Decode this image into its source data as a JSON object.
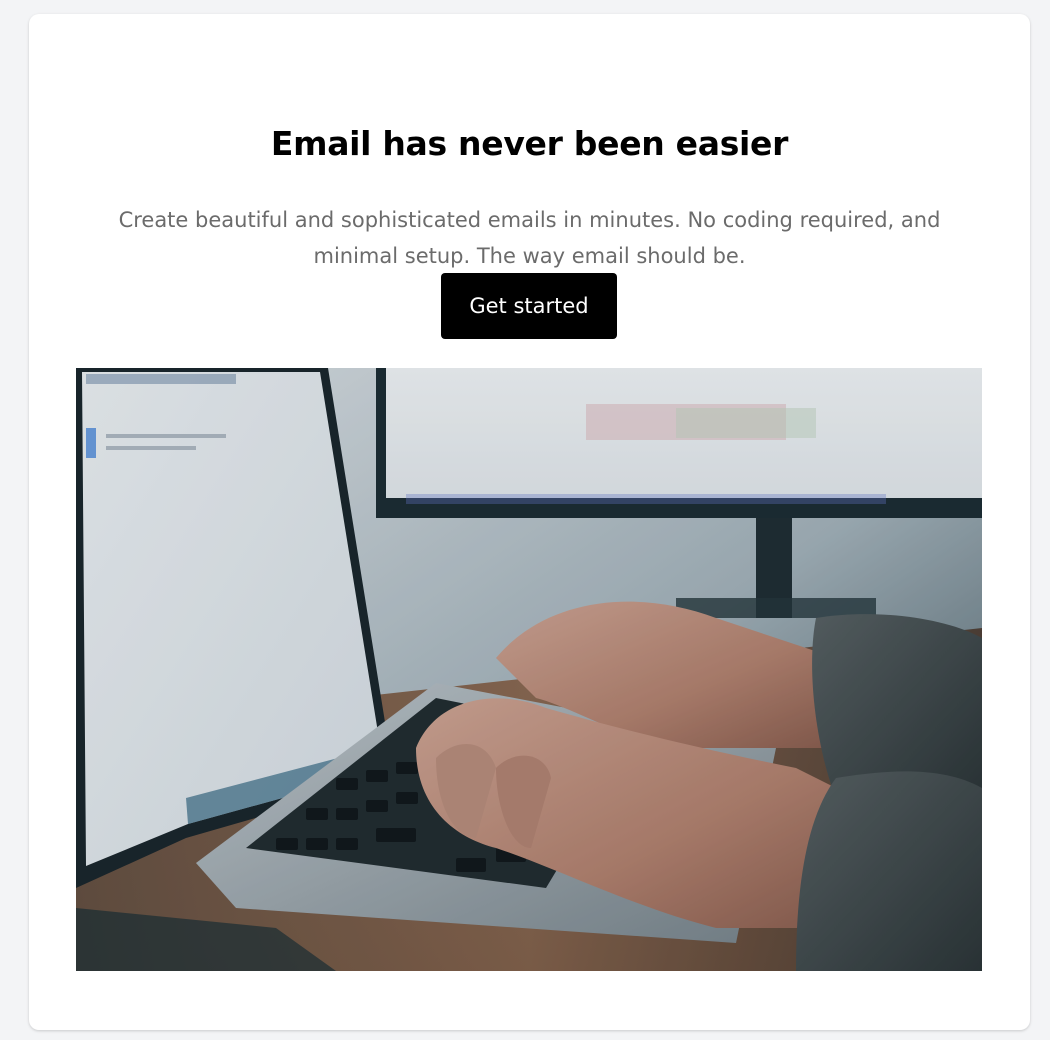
{
  "hero": {
    "title": "Email has never been easier",
    "subtitle": "Create beautiful and sophisticated emails in minutes. No coding required, and minimal setup. The way email should be.",
    "cta_label": "Get started"
  },
  "colors": {
    "page_background": "#f3f4f6",
    "card_background": "#ffffff",
    "title_text": "#000000",
    "subtitle_text": "#6b6b6b",
    "button_background": "#000000",
    "button_text": "#ffffff"
  },
  "image": {
    "subject": "hands typing on a laptop keyboard with a desktop monitor in the background"
  }
}
